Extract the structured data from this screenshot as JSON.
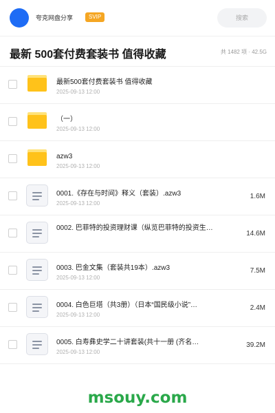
{
  "app": {
    "name": "夸克网盘分享",
    "badge": "SVIP"
  },
  "search": {
    "placeholder": "搜索"
  },
  "header": {
    "title": "最新 500套付费套装书 值得收藏",
    "summary": "共 1482 项 · 42.5G"
  },
  "items": [
    {
      "type": "folder",
      "name": "最新500套付费套装书 值得收藏",
      "date": "2025-09-13 12:00",
      "size": ""
    },
    {
      "type": "folder",
      "name": "（一）",
      "date": "2025-09-13 12:00",
      "size": ""
    },
    {
      "type": "folder",
      "name": "azw3",
      "date": "2025-09-13 12:00",
      "size": ""
    },
    {
      "type": "file",
      "name": "0001.《存在与时间》释义（套装）.azw3",
      "date": "2025-09-13 12:00",
      "size": "1.6M"
    },
    {
      "type": "file",
      "name": "0002. 巴菲特的投资理财课（纵览巴菲特的投资生…",
      "date": "",
      "size": "14.6M"
    },
    {
      "type": "file",
      "name": "0003. 巴金文集（套装共19本）.azw3",
      "date": "2025-09-13 12:00",
      "size": "7.5M"
    },
    {
      "type": "file",
      "name": "0004. 白色巨塔（共3册）（日本“国民级小说”…",
      "date": "2025-09-13 12:00",
      "size": "2.4M"
    },
    {
      "type": "file",
      "name": "0005. 白寿彝史学二十讲套装(共十一册 (齐名…",
      "date": "2025-09-13 12:00",
      "size": "39.2M"
    }
  ],
  "footer": {
    "brand": "msouy.com"
  },
  "colors": {
    "accent": "#1e6cf5",
    "svip": "#f5a623",
    "folder": "#ffc21a",
    "brand": "#2aa84a"
  }
}
